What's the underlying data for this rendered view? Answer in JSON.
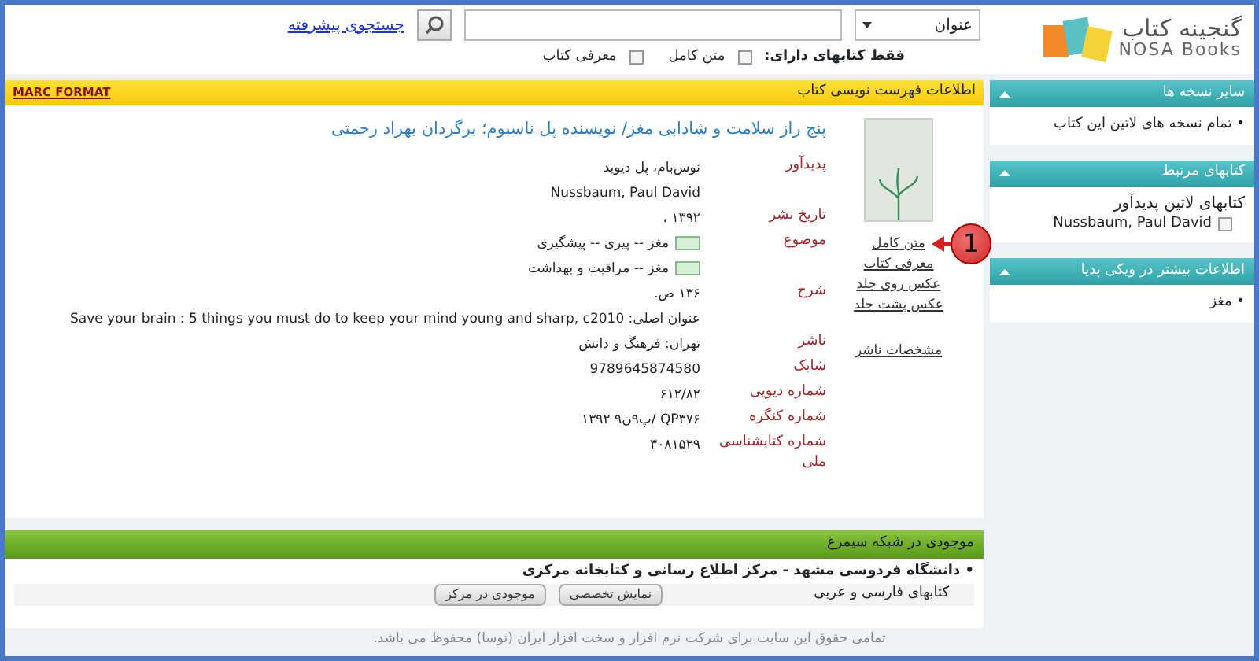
{
  "logo": {
    "text": "گنجینه کتاب",
    "subtext": "NOSA Books"
  },
  "search": {
    "field_selector": "عنوان",
    "advanced_link": "جستجوی پیشرفته",
    "filter_label": "فقط کتابهای دارای:",
    "filters": [
      {
        "label": "متن کامل",
        "checked": false
      },
      {
        "label": "معرفی کتاب",
        "checked": false
      }
    ]
  },
  "sidebar": [
    {
      "title": "سایر نسخه ها",
      "items": [
        {
          "text": "• تمام نسخه های لاتین این کتاب",
          "kind": "bullet"
        }
      ]
    },
    {
      "title": "کتابهای مرتبط",
      "items": [
        {
          "text": "کتابهای لاتین پدیدآور",
          "kind": "heading"
        },
        {
          "text": "Nussbaum, Paul David",
          "kind": "checkbox",
          "checked": false
        }
      ]
    },
    {
      "title": "اطلاعات بیشتر در ویکی پدیا",
      "items": [
        {
          "text": "• مغز",
          "kind": "bullet"
        }
      ]
    }
  ],
  "catalog_panel": {
    "title": "اطلاعات فهرست نویسی کتاب",
    "marc_link": "MARC FORMAT",
    "cover_links": [
      "متن کامل",
      "معرفی کتاب",
      "عکس روی جلد",
      "عکس پشت جلد"
    ],
    "publisher_link": "مشخصات ناشر",
    "book_title": "پنج راز سلامت و شادابی مغز/ نویسنده پل ناسبوم؛ برگردان بهراد رحمتی",
    "fields": [
      {
        "label": "پدیدآور",
        "values": [
          {
            "text": "نوس‌بام، پل دیوید",
            "kind": "link"
          },
          {
            "text": "Nussbaum, Paul David",
            "kind": "plain"
          }
        ]
      },
      {
        "label": "تاریخ نشر",
        "values": [
          {
            "text": "۱۳۹۲ ،",
            "kind": "plain"
          }
        ]
      },
      {
        "label": "موضوع",
        "values": [
          {
            "text": "مغز -- پیری -- پیشگیری",
            "kind": "subject"
          },
          {
            "text": "مغز -- مراقبت و بهداشت",
            "kind": "subject"
          }
        ]
      },
      {
        "label": "شرح",
        "values": [
          {
            "text": "۱۳۶ ص.",
            "kind": "plain"
          },
          {
            "text": "عنوان اصلی: Save your brain : 5 things you must do to keep your mind young and sharp, c2010",
            "kind": "plain"
          }
        ]
      },
      {
        "label": "ناشر",
        "values": [
          {
            "text": "تهران: فرهنگ و دانش",
            "kind": "link"
          }
        ]
      },
      {
        "label": "شابک",
        "values": [
          {
            "text": "9789645874580",
            "kind": "plain"
          }
        ]
      },
      {
        "label": "شماره دیویی",
        "values": [
          {
            "text": "۶۱۲/۸۲",
            "kind": "plain"
          }
        ]
      },
      {
        "label": "شماره کنگره",
        "values": [
          {
            "text": "QP۳۷۶ /پ۹ن۹ ۱۳۹۲",
            "kind": "plain"
          }
        ]
      },
      {
        "label": "شماره کتابشناسی ملی",
        "values": [
          {
            "text": "۳۰۸۱۵۲۹",
            "kind": "plain"
          }
        ]
      }
    ]
  },
  "availability": {
    "title": "موجودی در شبکه سیمرغ",
    "library": "• دانشگاه فردوسی مشهد - مرکز اطلاع رسانی و کتابخانه مرکزی",
    "collection": "کتابهای فارسی و عربی",
    "buttons": [
      "نمایش تخصصی",
      "موجودی در مرکز"
    ]
  },
  "footer": {
    "before": "تمامی حقوق این سایت برای شرکت نرم افزار و سخت افزار ایران (",
    "link": "نوسا",
    "after": ") محفوظ می باشد."
  },
  "annotation": {
    "number": "1"
  }
}
